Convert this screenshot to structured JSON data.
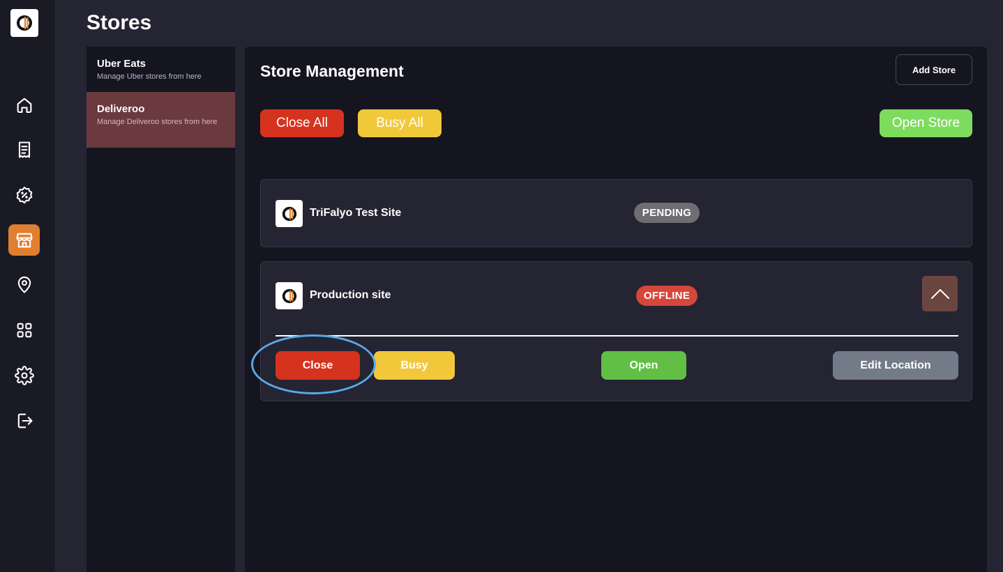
{
  "page": {
    "title": "Stores"
  },
  "nav": {
    "logo_icon": "app-logo-icon",
    "items": [
      {
        "icon": "home-icon"
      },
      {
        "icon": "receipt-icon"
      },
      {
        "icon": "discount-icon"
      },
      {
        "icon": "store-icon",
        "active": true
      },
      {
        "icon": "location-pin-icon"
      },
      {
        "icon": "grid-icon"
      },
      {
        "icon": "gear-icon"
      },
      {
        "icon": "logout-icon"
      }
    ],
    "active_color": "#e07f2f"
  },
  "providers": [
    {
      "name": "Uber Eats",
      "description": "Manage Uber stores from here"
    },
    {
      "name": "Deliveroo",
      "description": "Manage Deliveroo stores from here",
      "selected": true
    }
  ],
  "main": {
    "title": "Store Management",
    "add_store_label": "Add Store",
    "close_all_label": "Close All",
    "busy_all_label": "Busy All",
    "open_store_label": "Open Store"
  },
  "stores": [
    {
      "name": "TriFalyo Test Site",
      "status": "PENDING"
    },
    {
      "name": "Production site",
      "status": "OFFLINE",
      "expanded": true,
      "actions": {
        "close_label": "Close",
        "busy_label": "Busy",
        "open_label": "Open",
        "edit_location_label": "Edit Location"
      }
    }
  ],
  "colors": {
    "close": "#d6331f",
    "busy": "#f2c83b",
    "open": "#62bf45",
    "open_store": "#7ddc5e",
    "edit": "#737b88",
    "pending_badge": "#6e6e72",
    "offline_badge": "#d6463a",
    "highlight": "#5aa8e8"
  }
}
